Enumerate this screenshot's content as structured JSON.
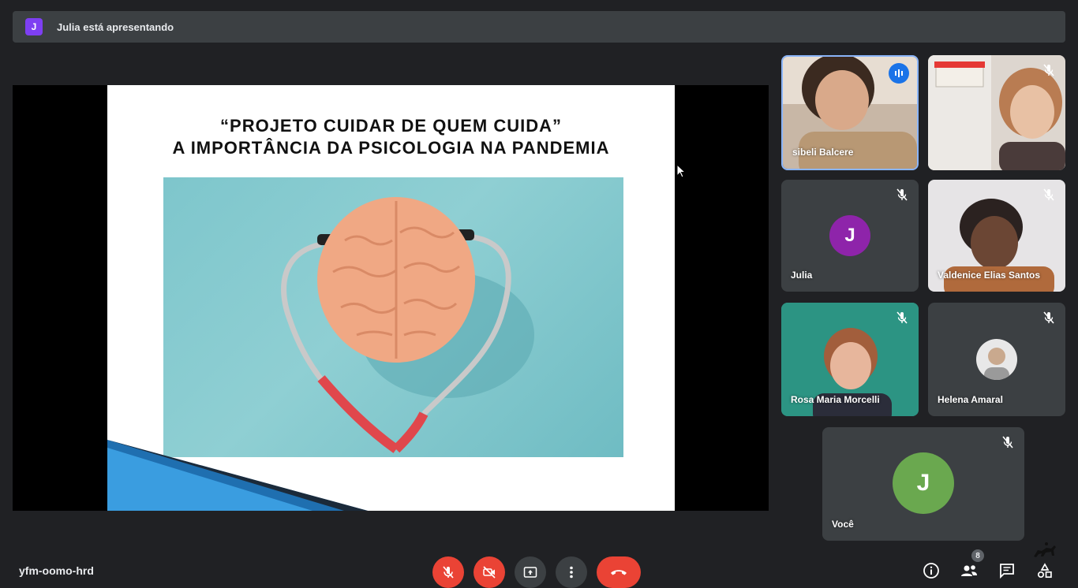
{
  "banner": {
    "avatar_letter": "J",
    "text": "Julia está apresentando"
  },
  "slide": {
    "title_line1": "“PROJETO CUIDAR DE QUEM CUIDA”",
    "title_line2": "A IMPORTÂNCIA DA PSICOLOGIA NA PANDEMIA"
  },
  "participants": [
    {
      "name": "sibeli Balcere",
      "speaking": true,
      "muted": false
    },
    {
      "name": "",
      "muted": true
    },
    {
      "name": "Julia",
      "avatar_letter": "J",
      "avatar_color": "#8e24aa",
      "muted": true
    },
    {
      "name": "Valdenice Elias Santos",
      "muted": true
    },
    {
      "name": "Rosa Maria Morcelli",
      "muted": true
    },
    {
      "name": "Helena Amaral",
      "muted": true
    }
  ],
  "self": {
    "name": "Você",
    "avatar_letter": "J",
    "avatar_color": "#6aa84f",
    "muted": true
  },
  "meeting": {
    "code": "yfm-oomo-hrd",
    "participant_count": "8"
  },
  "colors": {
    "accent_red": "#ea4335",
    "speaking_blue": "#1a73e8",
    "tile_bg": "#3c4043"
  },
  "icons": {
    "controls": [
      "mic-off-icon",
      "camera-off-icon",
      "present-screen-icon",
      "more-options-icon",
      "hang-up-icon"
    ],
    "right": [
      "info-icon",
      "people-icon",
      "chat-icon",
      "activities-icon"
    ]
  }
}
